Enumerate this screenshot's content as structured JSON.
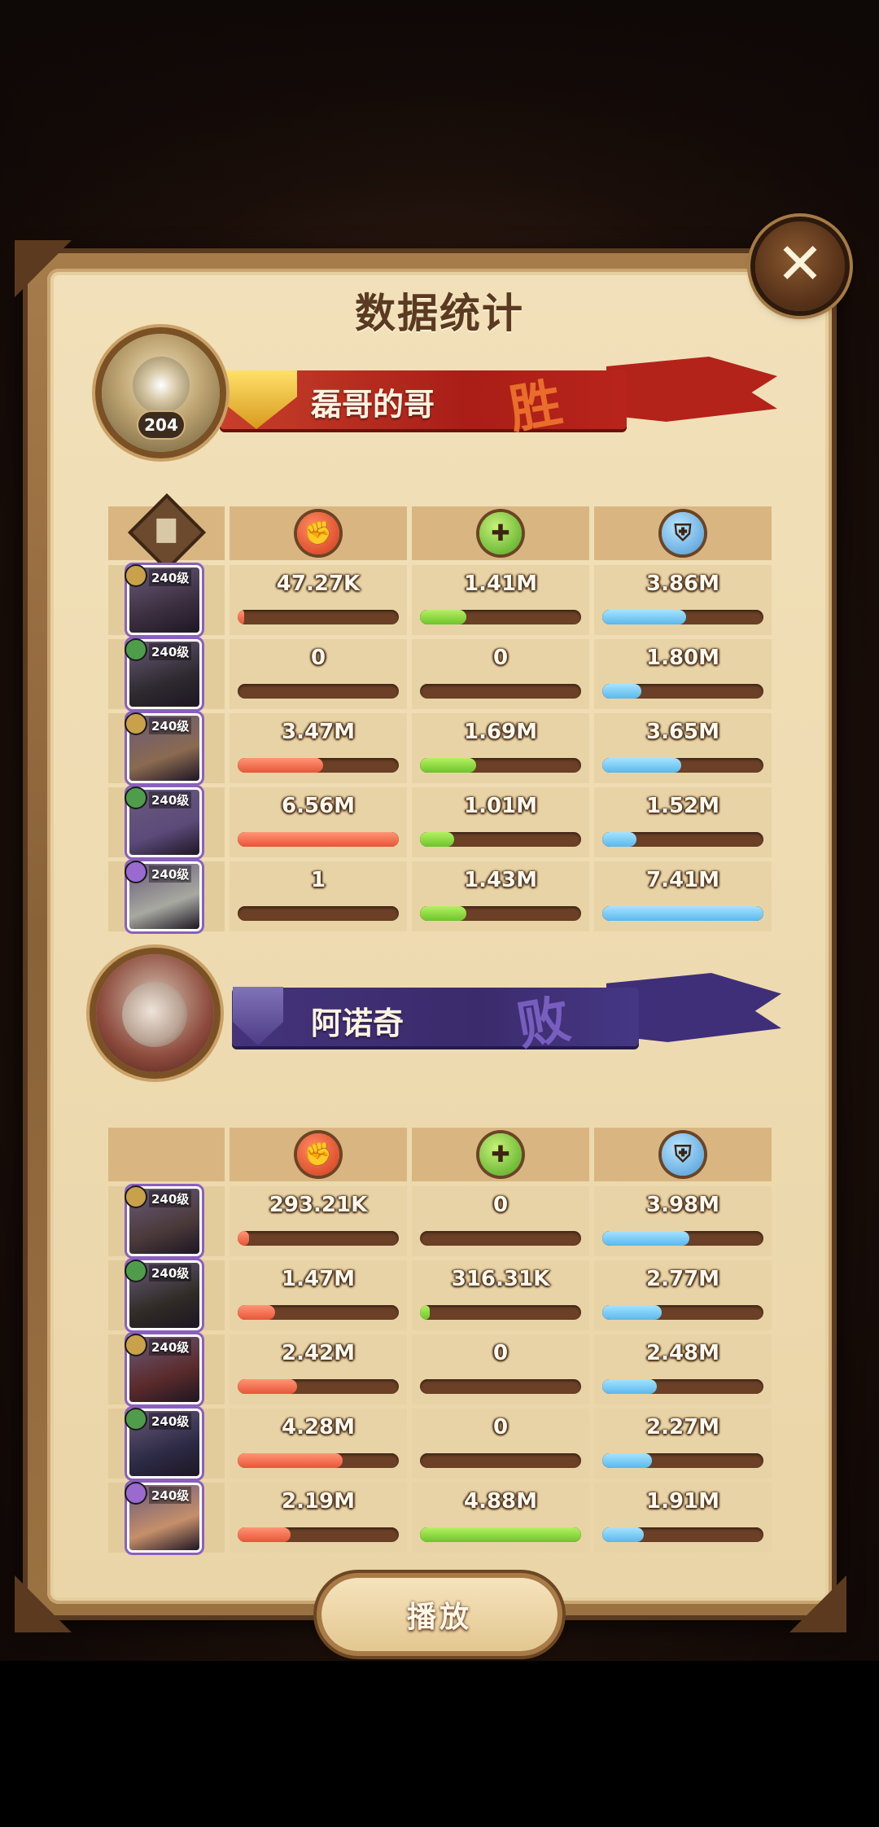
{
  "window": {
    "title": "数据统计",
    "close_icon": "close-icon"
  },
  "winner": {
    "name": "磊哥的哥",
    "result": "胜",
    "level": "204",
    "banner_color": "#b3231a"
  },
  "loser": {
    "name": "阿诺奇",
    "result": "败",
    "banner_color": "#3f2f78"
  },
  "columns": {
    "hero_icon": "document-icon",
    "damage_icon": "damage-fist-icon",
    "heal_icon": "heal-icon",
    "shield_icon": "shield-icon",
    "colors": {
      "damage": "#e85538",
      "heal": "#6dc42c",
      "shield": "#5bb8ec"
    }
  },
  "team1": [
    {
      "level": "240级",
      "damage": "47.27K",
      "heal": "1.41M",
      "shield": "3.86M",
      "damage_fill": 0.01,
      "heal_fill": 0.29,
      "shield_fill": 0.52,
      "portrait": "#3b2f3f"
    },
    {
      "level": "240级",
      "damage": "0",
      "heal": "0",
      "shield": "1.80M",
      "damage_fill": 0,
      "heal_fill": 0,
      "shield_fill": 0.24,
      "portrait": "#2e2a2f"
    },
    {
      "level": "240级",
      "damage": "3.47M",
      "heal": "1.69M",
      "shield": "3.65M",
      "damage_fill": 0.53,
      "heal_fill": 0.35,
      "shield_fill": 0.49,
      "portrait": "#8a6a50"
    },
    {
      "level": "240级",
      "damage": "6.56M",
      "heal": "1.01M",
      "shield": "1.52M",
      "damage_fill": 1.0,
      "heal_fill": 0.21,
      "shield_fill": 0.21,
      "portrait": "#5c4a7a"
    },
    {
      "level": "240级",
      "damage": "1",
      "heal": "1.43M",
      "shield": "7.41M",
      "damage_fill": 0,
      "heal_fill": 0.29,
      "shield_fill": 1.0,
      "portrait": "#a7a9a0"
    }
  ],
  "team2": [
    {
      "level": "240级",
      "damage": "293.21K",
      "heal": "0",
      "shield": "3.98M",
      "damage_fill": 0.07,
      "heal_fill": 0,
      "shield_fill": 0.54,
      "portrait": "#4a3a3a"
    },
    {
      "level": "240级",
      "damage": "1.47M",
      "heal": "316.31K",
      "shield": "2.77M",
      "damage_fill": 0.23,
      "heal_fill": 0.06,
      "shield_fill": 0.37,
      "portrait": "#2f2b25"
    },
    {
      "level": "240级",
      "damage": "2.42M",
      "heal": "0",
      "shield": "2.48M",
      "damage_fill": 0.37,
      "heal_fill": 0,
      "shield_fill": 0.34,
      "portrait": "#5a2a2a"
    },
    {
      "level": "240级",
      "damage": "4.28M",
      "heal": "0",
      "shield": "2.27M",
      "damage_fill": 0.65,
      "heal_fill": 0,
      "shield_fill": 0.31,
      "portrait": "#2c2a45"
    },
    {
      "level": "240级",
      "damage": "2.19M",
      "heal": "4.88M",
      "shield": "1.91M",
      "damage_fill": 0.33,
      "heal_fill": 1.0,
      "shield_fill": 0.26,
      "portrait": "#c58f6a"
    }
  ],
  "actions": {
    "play_label": "播放"
  }
}
